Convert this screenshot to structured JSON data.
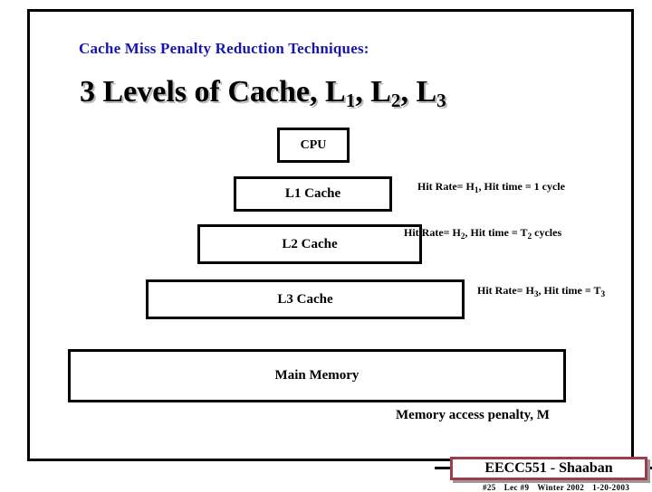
{
  "slide": {
    "subtitle": "Cache Miss Penalty Reduction Techniques:",
    "title_prefix": "3 Levels of Cache, L",
    "title_sub1": "1",
    "title_mid1": ", L",
    "title_sub2": "2",
    "title_mid2": ", L",
    "title_sub3": "3",
    "title_plain": "3 Levels of Cache, L1, L2, L3"
  },
  "diagram": {
    "cpu": {
      "label": "CPU"
    },
    "levels": [
      {
        "box_label": "L1 Cache",
        "annotation_prefix": "Hit Rate= H",
        "annotation_sub1": "1",
        "annotation_mid": ", Hit time = 1 cycle",
        "annotation_sub2": "",
        "annotation_suffix": "",
        "annotation_plain": "Hit Rate= H1, Hit time = 1 cycle"
      },
      {
        "box_label": "L2 Cache",
        "annotation_prefix": "Hit Rate= H",
        "annotation_sub1": "2",
        "annotation_mid": ",  Hit time = T",
        "annotation_sub2": "2",
        "annotation_suffix": "  cycles",
        "annotation_plain": "Hit Rate= H2,  Hit time = T2  cycles"
      },
      {
        "box_label": "L3 Cache",
        "annotation_prefix": "Hit Rate= H",
        "annotation_sub1": "3",
        "annotation_mid": ",  Hit time = T",
        "annotation_sub2": "3",
        "annotation_suffix": "",
        "annotation_plain": "Hit Rate= H3,  Hit time = T3"
      }
    ],
    "main_memory": {
      "label": "Main Memory"
    },
    "memory_penalty_note": "Memory access penalty, M"
  },
  "footer": {
    "badge_label": "EECC551 - Shaaban",
    "slide_number": "#25",
    "lecture": "Lec #9",
    "term": "Winter 2002",
    "date": "1-20-2003"
  },
  "colors": {
    "subtitle": "#1717b0",
    "frame": "#000000",
    "badge_border": "#9e3b4c",
    "badge_shadow": "#9a9a9a",
    "title_shadow": "#b9b9b9"
  }
}
